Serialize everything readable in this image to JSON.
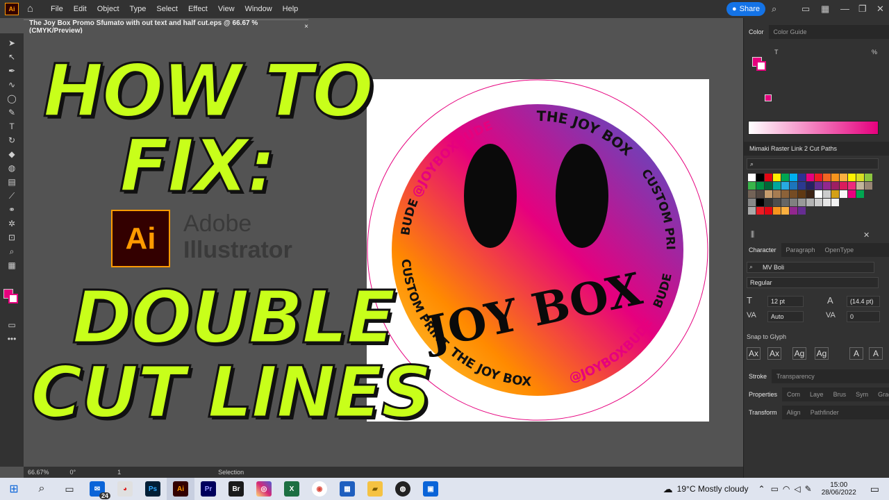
{
  "menubar": {
    "app_logo": "Ai",
    "home_icon": "home-icon",
    "menus": [
      "File",
      "Edit",
      "Object",
      "Type",
      "Select",
      "Effect",
      "View",
      "Window",
      "Help"
    ],
    "share_label": "Share"
  },
  "document": {
    "tab_title": "The Joy Box Promo Sfumato with out text and half cut.eps @ 66.67 % (CMYK/Preview)",
    "close": "×"
  },
  "overlay": {
    "line1": "HOW TO",
    "line2": "FIX:",
    "line3": "DOUBLE",
    "line4": "CUT LINES",
    "ai_badge": "Ai",
    "adobe_line1": "Adobe",
    "adobe_line2": "Illustrator"
  },
  "artwork": {
    "ring_text_top": "THE JOY BOX",
    "ring_handle_top": "@JOYBOXBUDE",
    "ring_right": "CUSTOM PRINT",
    "ring_left": "BUDE",
    "ring_left_lower": "CUSTOM PRINT",
    "ring_right_lower": "BUDE",
    "ring_bottom": "THE JOY BOX",
    "ring_handle_bottom": "@JOYBOXBUDE",
    "face_word": "JOY BOX",
    "colors": {
      "pink": "#e6007e",
      "purple": "#6a4cb0",
      "orange": "#ff8a00",
      "yellow": "#ffd23a"
    }
  },
  "statusbar": {
    "zoom": "66.67%",
    "rotation": "0°",
    "artboard": "1",
    "tool": "Selection"
  },
  "panels": {
    "color_tabs": [
      "Color",
      "Color Guide"
    ],
    "color_t": "T",
    "color_pct": "%",
    "swatch_panel_title": "Mimaki Raster Link 2 Cut Paths",
    "character_tabs": [
      "Character",
      "Paragraph",
      "OpenType"
    ],
    "font_family": "MV Boli",
    "font_style": "Regular",
    "font_size": "12 pt",
    "leading": "(14.4 pt)",
    "kerning": "Auto",
    "tracking": "0",
    "snap_label": "Snap to Glyph",
    "stroke_tabs": [
      "Stroke",
      "Transparency"
    ],
    "properties_tabs": [
      "Properties",
      "Com",
      "Laye",
      "Brus",
      "Sym",
      "Gradi"
    ],
    "transform_tabs": [
      "Transform",
      "Align",
      "Pathfinder"
    ]
  },
  "taskbar": {
    "mail_badge": "24",
    "apps": [
      "Ps",
      "Ai",
      "Pr",
      "Br"
    ],
    "weather": "19°C  Mostly cloudy",
    "time": "15:00",
    "date": "28/06/2022"
  }
}
